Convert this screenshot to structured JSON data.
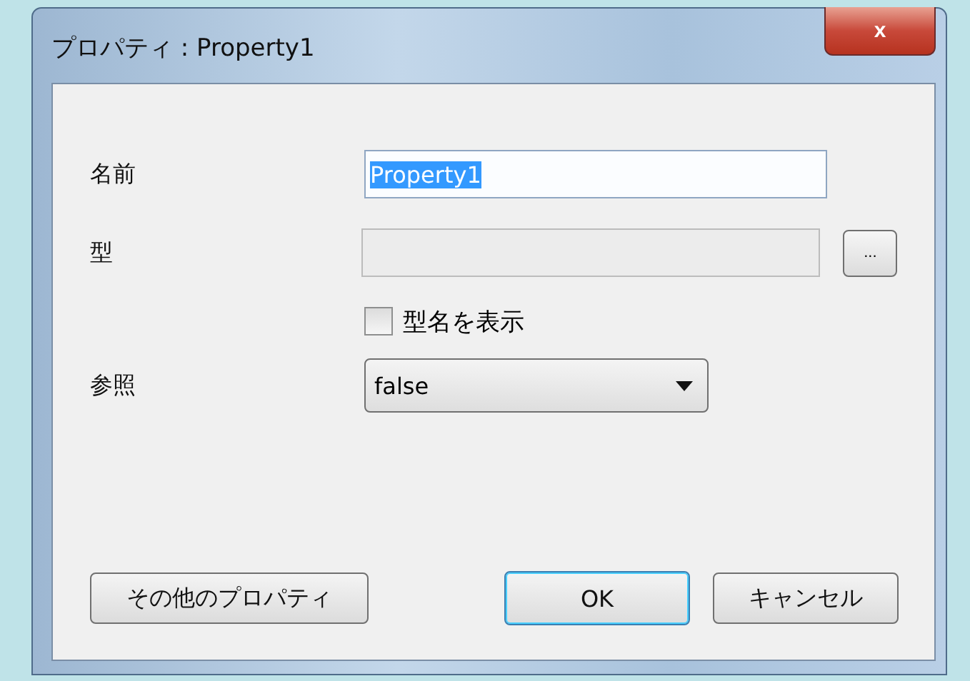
{
  "window": {
    "title": "プロパティ : Property1",
    "close": "x"
  },
  "fields": [
    {
      "kind": "text",
      "label": "名前",
      "value": "Property1",
      "text_selected": true,
      "disabled": false
    },
    {
      "kind": "browse",
      "label": "型",
      "disabled": true,
      "button": "..."
    },
    {
      "kind": "checkbox",
      "label": "型名を表示",
      "checked": false
    },
    {
      "kind": "dropdown",
      "label": "参照",
      "value": "false"
    }
  ],
  "buttons": [
    {
      "label": "その他のプロパティ",
      "default": false
    },
    {
      "label": "OK",
      "default": true
    },
    {
      "label": "キャンセル",
      "default": false
    }
  ]
}
